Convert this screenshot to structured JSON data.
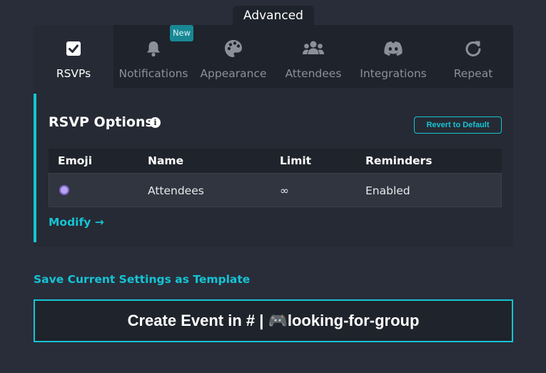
{
  "section_tab": "Advanced",
  "tabs": [
    {
      "label": "RSVPs",
      "icon": "checkbox-icon",
      "active": true
    },
    {
      "label": "Notifications",
      "icon": "bell-icon",
      "badge": "New"
    },
    {
      "label": "Appearance",
      "icon": "palette-icon"
    },
    {
      "label": "Attendees",
      "icon": "users-icon"
    },
    {
      "label": "Integrations",
      "icon": "discord-icon"
    },
    {
      "label": "Repeat",
      "icon": "repeat-icon"
    }
  ],
  "panel": {
    "title": "RSVP Options",
    "info_glyph": "i",
    "revert_label": "Revert to Default",
    "table": {
      "headers": [
        "Emoji",
        "Name",
        "Limit",
        "Reminders"
      ],
      "rows": [
        {
          "emoji": "custom-emoji-icon",
          "name": "Attendees",
          "limit": "∞",
          "reminders": "Enabled"
        }
      ]
    },
    "modify_label": "Modify",
    "modify_arrow": "→"
  },
  "save_template_label": "Save Current Settings as Template",
  "create_button_label": "Create Event in # | 🎮looking-for-group",
  "colors": {
    "background": "#292d3a",
    "panel": "#262a34",
    "tab_bar": "#1f232b",
    "accent": "#15c4d4",
    "badge": "#178894"
  }
}
